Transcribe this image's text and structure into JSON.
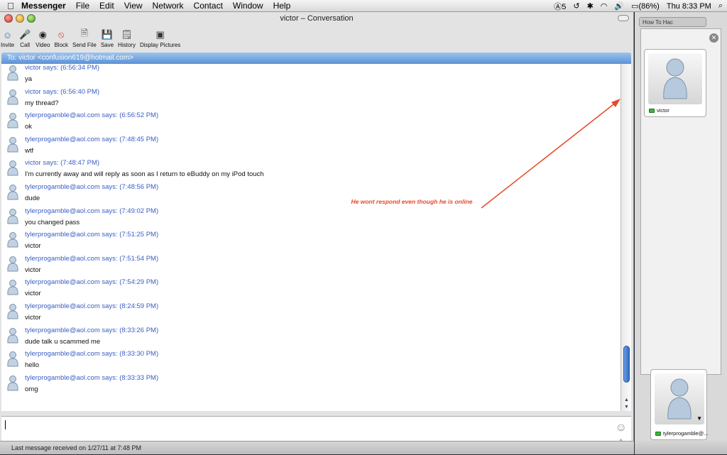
{
  "menubar": {
    "app_name": "Messenger",
    "items": [
      "File",
      "Edit",
      "View",
      "Network",
      "Contact",
      "Window",
      "Help"
    ],
    "status": {
      "adobe_badge": "5",
      "battery": "(86%)",
      "clock": "Thu 8:33 PM"
    }
  },
  "window": {
    "title": "victor – Conversation",
    "toolbar": [
      {
        "label": "Invite",
        "icon": "invite-icon"
      },
      {
        "label": "Call",
        "icon": "microphone-icon"
      },
      {
        "label": "Video",
        "icon": "webcam-icon"
      },
      {
        "label": "Block",
        "icon": "block-icon"
      },
      {
        "label": "Send File",
        "icon": "send-file-icon"
      },
      {
        "label": "Save",
        "icon": "floppy-disk-icon"
      },
      {
        "label": "History",
        "icon": "history-icon"
      },
      {
        "label": "Display Pictures",
        "icon": "display-pictures-icon"
      }
    ],
    "to_line": "To: victor <confusion619@hotmail.com>",
    "messages": [
      {
        "sender": "victor says: (6:56:34 PM)",
        "text": "ya"
      },
      {
        "sender": "victor says: (6:56:40 PM)",
        "text": "my thread?"
      },
      {
        "sender": "tylerprogamble@aol.com says: (6:56:52 PM)",
        "text": "ok"
      },
      {
        "sender": "tylerprogamble@aol.com says: (7:48:45 PM)",
        "text": "wtf"
      },
      {
        "sender": "victor says: (7:48:47 PM)",
        "text": "I'm currently away and will reply as soon as I return to eBuddy on my iPod touch"
      },
      {
        "sender": "tylerprogamble@aol.com says: (7:48:56 PM)",
        "text": "dude"
      },
      {
        "sender": "tylerprogamble@aol.com says: (7:49:02 PM)",
        "text": "you changed pass"
      },
      {
        "sender": "tylerprogamble@aol.com says: (7:51:25 PM)",
        "text": "victor"
      },
      {
        "sender": "tylerprogamble@aol.com says: (7:51:54 PM)",
        "text": "victor"
      },
      {
        "sender": "tylerprogamble@aol.com says: (7:54:29 PM)",
        "text": "victor"
      },
      {
        "sender": "tylerprogamble@aol.com says: (8:24:59 PM)",
        "text": "victor"
      },
      {
        "sender": "tylerprogamble@aol.com says: (8:33:26 PM)",
        "text": "dude talk u scammed me"
      },
      {
        "sender": "tylerprogamble@aol.com says: (8:33:30 PM)",
        "text": "hello"
      },
      {
        "sender": "tylerprogamble@aol.com says: (8:33:33 PM)",
        "text": "omg"
      }
    ],
    "input_value": "",
    "font_button": "Aa",
    "status_text": "Last message received on 1/27/11 at 7:48 PM"
  },
  "annotation": {
    "text": "He wont respond even though he is online",
    "color": "#e64a2a"
  },
  "buddy_panel": {
    "tab_label": "How To Hac",
    "contact_name": "victor",
    "self_name": "tylerprogamble@...",
    "status_color": "#3db33d"
  }
}
